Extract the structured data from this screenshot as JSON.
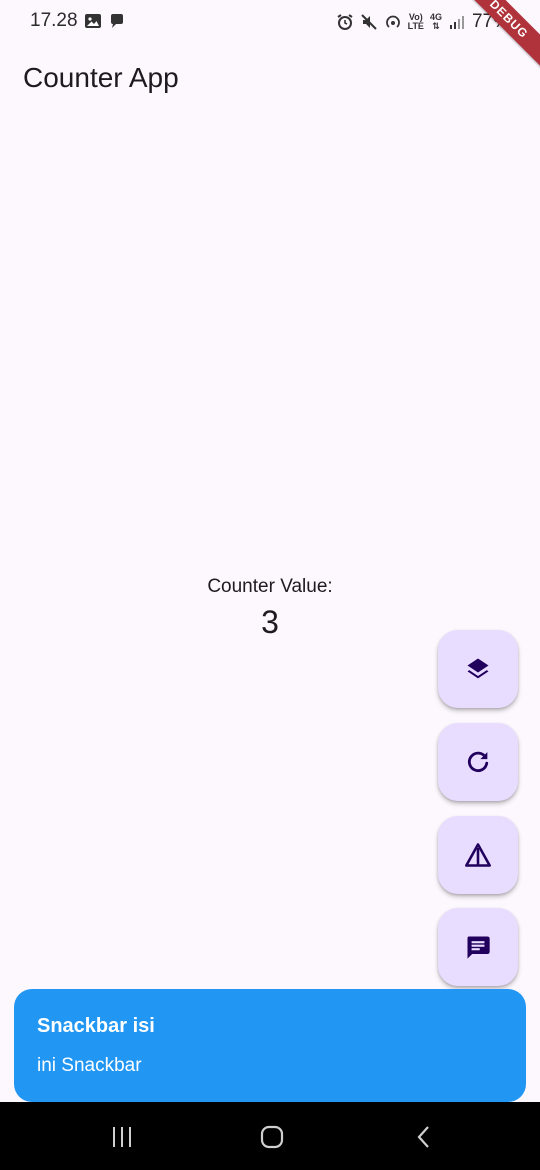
{
  "status_bar": {
    "time": "17.28",
    "battery": "77%",
    "net_top": "Vo)",
    "net_bottom": "LTE",
    "gen": "4G"
  },
  "debug_banner": "DEBUG",
  "app_bar": {
    "title": "Counter App"
  },
  "counter": {
    "label": "Counter Value:",
    "value": "3"
  },
  "fabs": [
    {
      "icon": "layers-icon"
    },
    {
      "icon": "refresh-icon"
    },
    {
      "icon": "warning-icon"
    },
    {
      "icon": "message-icon"
    }
  ],
  "snackbar": {
    "title": "Snackbar isi",
    "body": "ini Snackbar",
    "background": "#2196f3"
  },
  "colors": {
    "background": "#fdf7fe",
    "fab_background": "#e9ddff",
    "fab_icon": "#21005d",
    "debug_banner": "#b0323a"
  },
  "nav_bar": {
    "items": [
      "recent-apps-icon",
      "home-icon",
      "back-icon"
    ]
  }
}
